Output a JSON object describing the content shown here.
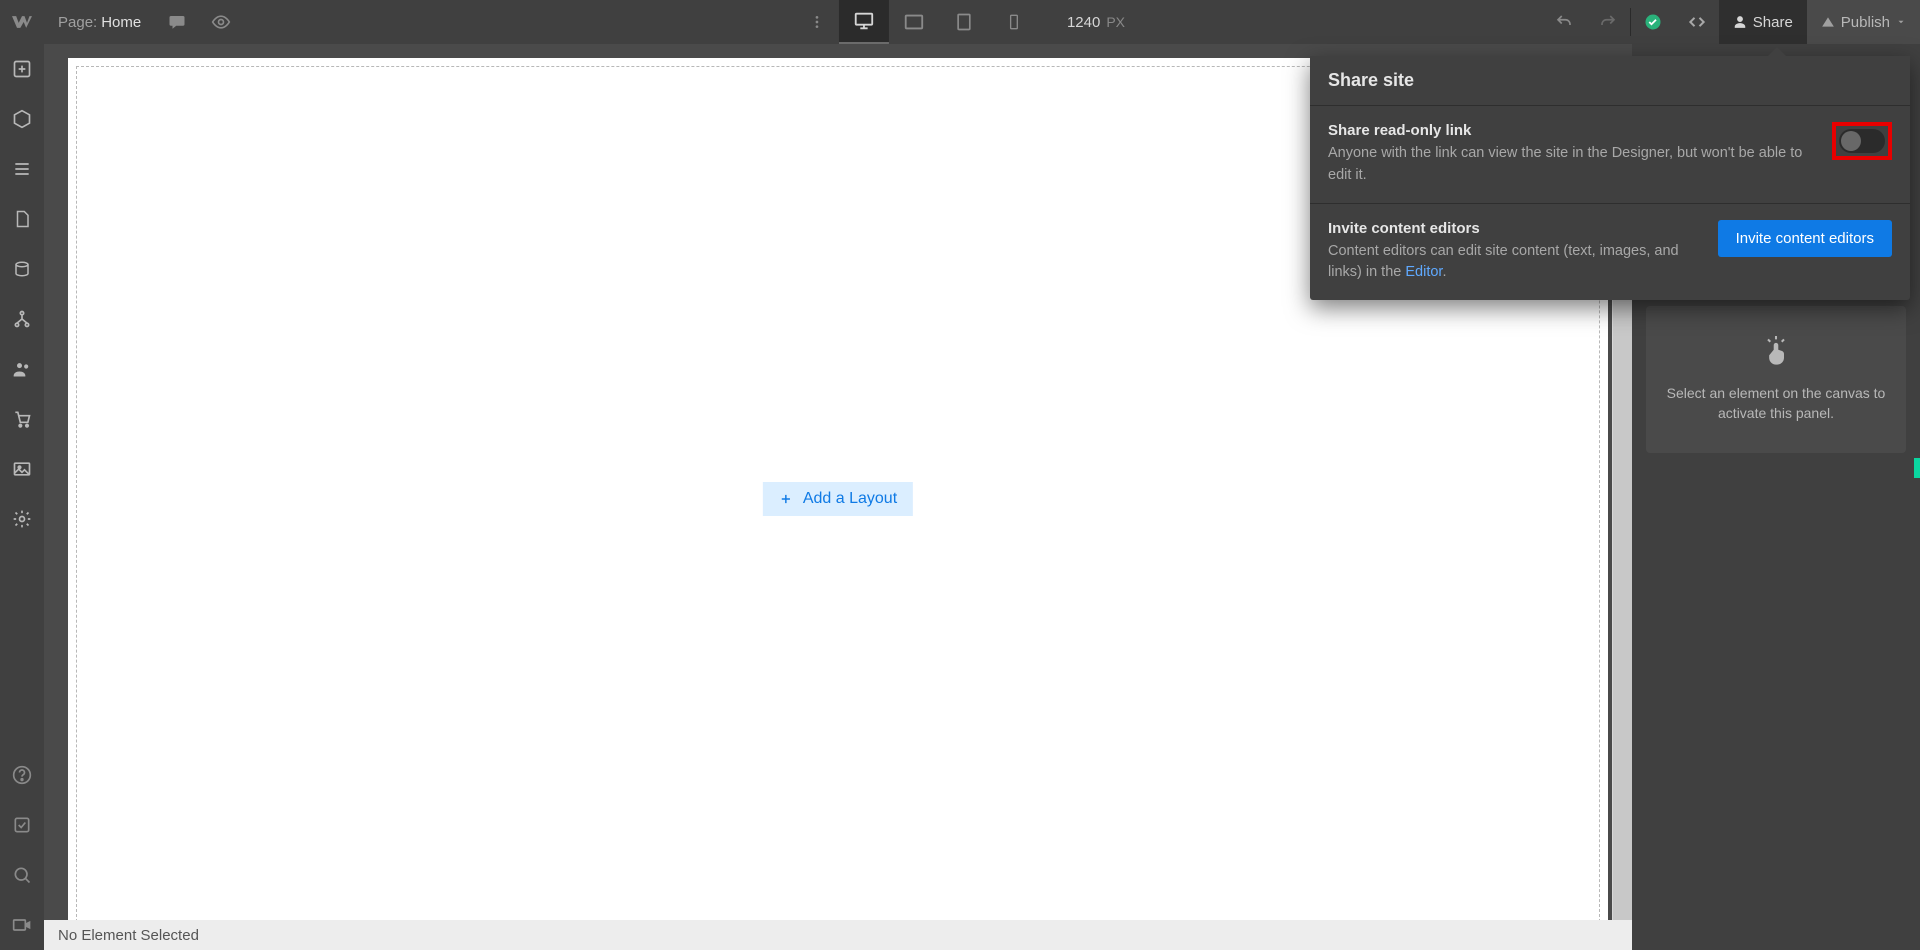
{
  "topbar": {
    "page_label": "Page:",
    "page_name": "Home",
    "canvas_width": "1240",
    "canvas_unit": "PX",
    "share_label": "Share",
    "publish_label": "Publish"
  },
  "canvas": {
    "add_layout_label": "Add a Layout"
  },
  "bottombar": {
    "status": "No Element Selected"
  },
  "right_panel": {
    "empty_text": "Select an element on the canvas to activate this panel."
  },
  "share_popover": {
    "title": "Share site",
    "readonly_title": "Share read-only link",
    "readonly_desc": "Anyone with the link can view the site in the Designer, but won't be able to edit it.",
    "editors_title": "Invite content editors",
    "editors_desc_prefix": "Content editors can edit site content (text, images, and links) in the ",
    "editors_link_text": "Editor",
    "editors_desc_suffix": ".",
    "invite_btn": "Invite content editors"
  }
}
